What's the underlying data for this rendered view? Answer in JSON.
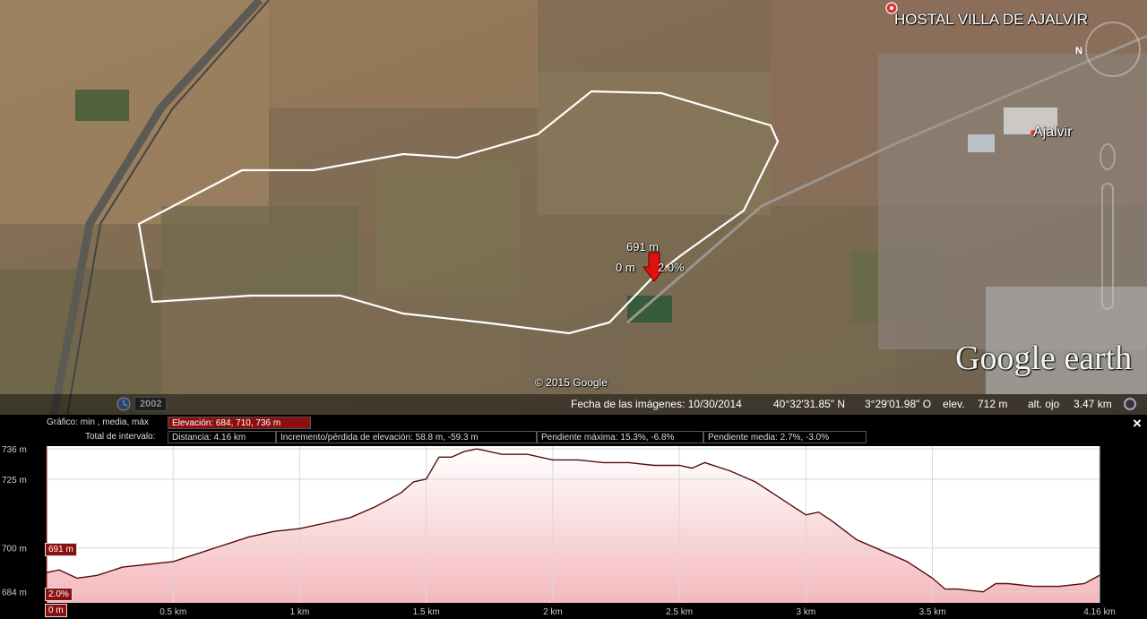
{
  "map": {
    "place_labels": {
      "hostal": "HOSTAL VILLA DE AJALVIR",
      "town": "Ajalvir"
    },
    "marker": {
      "elevation": "691 m",
      "distance": "0 m",
      "slope": "2.0%"
    },
    "copyright": "© 2015 Google",
    "logo": "Google earth",
    "historical_year": "2002",
    "icons": [
      "restaurant-icon",
      "compass-icon",
      "clock-icon",
      "street-view-pegman-icon",
      "zoom-slider-icon",
      "red-arrow-marker-icon"
    ]
  },
  "status": {
    "imagery_date": "Fecha de las imágenes: 10/30/2014",
    "lat": "40°32'31.85\" N",
    "lon": "3°29'01.98\" O",
    "elev_label": "elev.",
    "elev_value": "712 m",
    "eye_label": "alt. ojo",
    "eye_value": "3.47 km"
  },
  "profile": {
    "graph_label": "Gráfico: min , media, máx",
    "elevation_box": "Elevación: 684, 710, 736 m",
    "total_label": "Total de intervalo:",
    "distance_box": "Distancia: 4.16 km",
    "gain_box": "Incremento/pérdida de elevación: 58.8 m, -59.3 m",
    "max_slope_box": "Pendiente máxima: 15.3%, -6.8%",
    "avg_slope_box": "Pendiente media: 2.7%, -3.0%",
    "cursor_elev": "691 m",
    "cursor_slope": "2.0%",
    "cursor_dist": "0 m",
    "close_symbol": "×"
  },
  "chart_data": {
    "type": "area",
    "xlabel": "",
    "ylabel": "",
    "xlim": [
      0,
      4.16
    ],
    "ylim": [
      680,
      737
    ],
    "y_ticks": [
      684,
      700,
      725,
      736
    ],
    "y_tick_labels": [
      "684 m",
      "700 m",
      "725 m",
      "736 m"
    ],
    "x_ticks": [
      0.5,
      1,
      1.5,
      2,
      2.5,
      3,
      3.5,
      4.16
    ],
    "x_tick_labels": [
      "0.5 km",
      "1 km",
      "1.5 km",
      "2 km",
      "2.5 km",
      "3 km",
      "3.5 km",
      "4.16 km"
    ],
    "grid": true,
    "line_color": "#5a0a0a",
    "fill_color": "#f4b8bc",
    "series": [
      {
        "x": [
          0,
          0.05,
          0.12,
          0.2,
          0.3,
          0.4,
          0.5,
          0.6,
          0.7,
          0.8,
          0.9,
          1.0,
          1.1,
          1.2,
          1.3,
          1.4,
          1.45,
          1.5,
          1.55,
          1.6,
          1.65,
          1.7,
          1.8,
          1.9,
          2.0,
          2.1,
          2.2,
          2.3,
          2.4,
          2.5,
          2.55,
          2.6,
          2.7,
          2.8,
          2.9,
          3.0,
          3.05,
          3.1,
          3.2,
          3.3,
          3.4,
          3.5,
          3.55,
          3.6,
          3.7,
          3.75,
          3.8,
          3.9,
          4.0,
          4.1,
          4.16
        ],
        "y": [
          691,
          692,
          689,
          690,
          693,
          694,
          695,
          698,
          701,
          704,
          706,
          707,
          709,
          711,
          715,
          720,
          724,
          725,
          733,
          733,
          735,
          736,
          734,
          734,
          732,
          732,
          731,
          731,
          730,
          730,
          729,
          731,
          728,
          724,
          718,
          712,
          713,
          710,
          703,
          699,
          695,
          689,
          685,
          685,
          684,
          687,
          687,
          686,
          686,
          687,
          690
        ]
      }
    ]
  }
}
